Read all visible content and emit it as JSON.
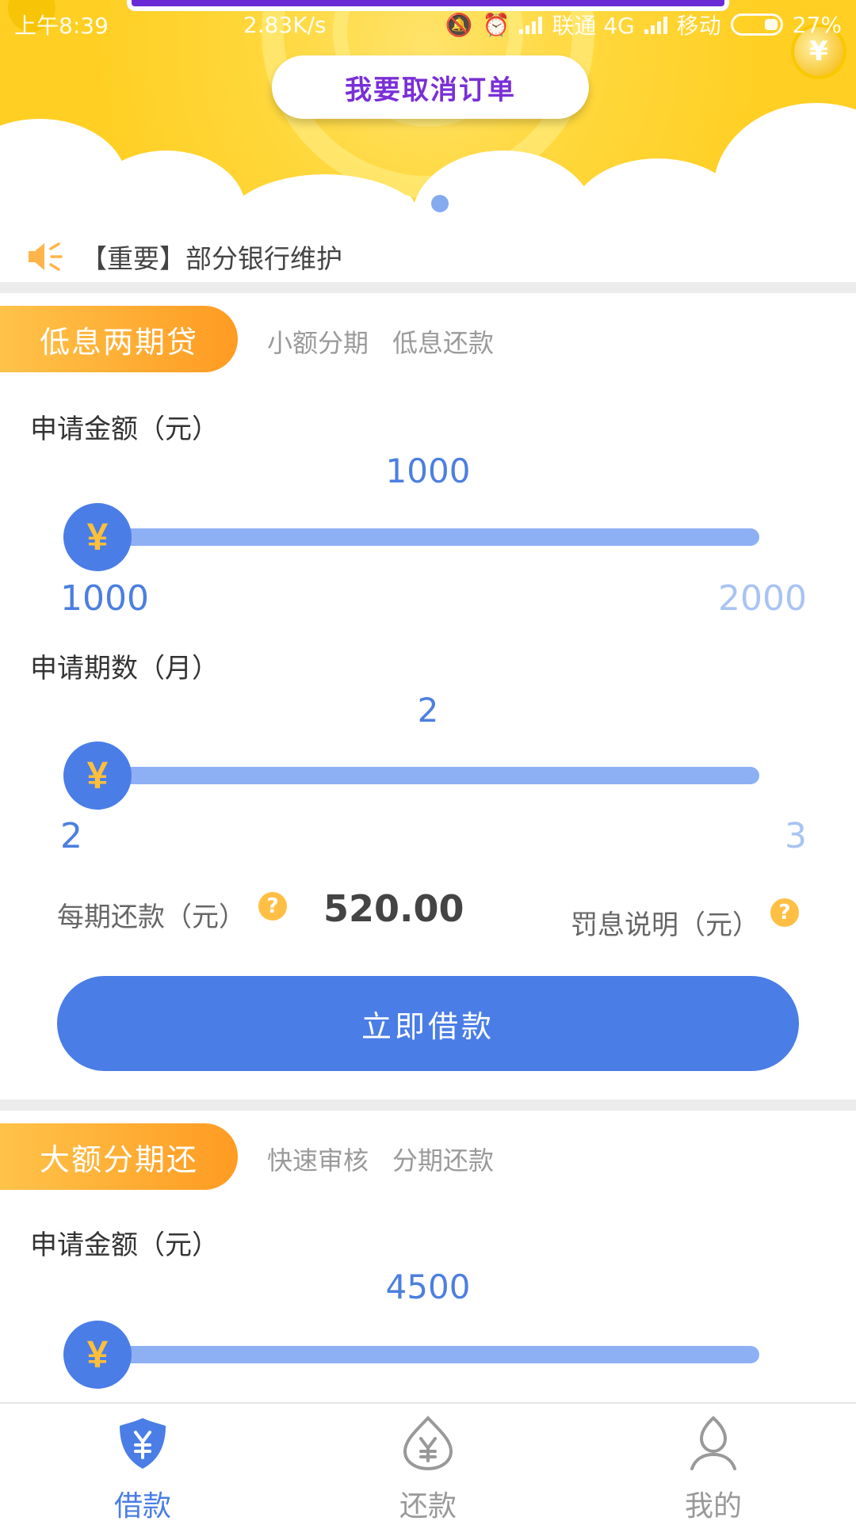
{
  "status_bar": {
    "time": "上午8:39",
    "speed": "2.83K/s",
    "carrier1": "联通 4G",
    "carrier2": "移动",
    "battery": "27%"
  },
  "banner": {
    "cancel_label": "我要取消订单",
    "page_index": 2,
    "page_count": 2
  },
  "notice": {
    "text": "【重要】部分银行维护"
  },
  "products": [
    {
      "tag": "低息两期贷",
      "sub_tags": [
        "小额分期",
        "低息还款"
      ],
      "amount_label": "申请金额（元）",
      "amount_value": "1000",
      "amount_min": "1000",
      "amount_max": "2000",
      "period_label": "申请期数（月）",
      "period_value": "2",
      "period_min": "2",
      "period_max": "3",
      "repay_label": "每期还款（元）",
      "repay_amount": "520.00",
      "penalty_label": "罚息说明（元）",
      "borrow_label": "立即借款"
    },
    {
      "tag": "大额分期还",
      "sub_tags": [
        "快速审核",
        "分期还款"
      ],
      "amount_label": "申请金额（元）",
      "amount_value": "4500"
    }
  ],
  "nav": {
    "items": [
      {
        "label": "借款",
        "icon": "loan-shield-icon",
        "active": true
      },
      {
        "label": "还款",
        "icon": "repay-drop-icon",
        "active": false
      },
      {
        "label": "我的",
        "icon": "user-icon",
        "active": false
      }
    ]
  },
  "colors": {
    "primary": "#4a7de6",
    "track": "#8db0f4",
    "accent_orange": "#ff9b22",
    "banner_yellow": "#ffd73a",
    "cancel_text": "#7a2fd6"
  },
  "icons": {
    "yen": "¥",
    "help": "?"
  }
}
